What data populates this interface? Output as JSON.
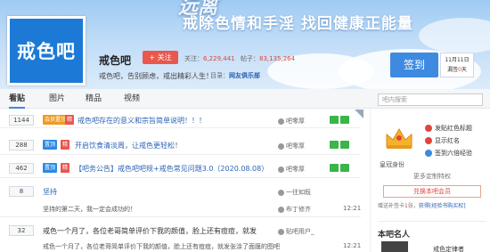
{
  "banner": {
    "slogan": "戒除色情和手淫 找回健康正能量",
    "top_text": "远离"
  },
  "logo": {
    "text": "戒色吧"
  },
  "forum": {
    "name": "戒色吧",
    "follow_label": "+ 关注",
    "members_label": "关注：",
    "members": "6,229,441",
    "posts_label": "帖子：",
    "posts": "83,135,264",
    "description": "戒色吧，告别顾虑，戒出精彩人生！",
    "directory_label": "目录：",
    "directory_link": "网友俱乐部"
  },
  "signin": {
    "label": "签到",
    "date": "11月11日",
    "streak_label": "漏签",
    "streak_num": "0",
    "streak_unit": "天"
  },
  "tabs": [
    {
      "label": "看贴"
    },
    {
      "label": "图片"
    },
    {
      "label": "精品"
    },
    {
      "label": "视频"
    }
  ],
  "search": {
    "placeholder": "吧内搜索"
  },
  "threads": [
    {
      "replies": "1144",
      "tags": [
        "会员置顶",
        "精"
      ],
      "title": "戒色吧存在的意义和宗旨简单说明！！！",
      "author": "吧零厚",
      "time": ""
    },
    {
      "replies": "288",
      "tags": [
        "置顶",
        "精"
      ],
      "title": "开启饮食清淡周，让戒色更轻松！",
      "author": "吧零厚",
      "time": ""
    },
    {
      "replies": "462",
      "tags": [
        "置顶",
        "精"
      ],
      "title": "【吧务公告】戒色吧吧规+戒色常见问题3.0（2020.08.08）",
      "author": "吧零厚",
      "time": ""
    },
    {
      "replies": "8",
      "tags": [],
      "title": "坚持",
      "preview": "坚持的第二天，我一定会成功的！",
      "author": "一往如既",
      "author2": "布丁修齐",
      "time": "12:21"
    },
    {
      "replies": "32",
      "tags": [],
      "title": "戒色一个月了，各位老哥简单评价下我的颜值，脸上还有痘痘，就发",
      "preview": "戒色一个月了，各位老哥简单评价下我的颜值，脸上还有痘痘，就发张涂了面膜的图吧",
      "author": "贴吧用户_",
      "time": "12:21"
    }
  ],
  "sidebar": {
    "links": [
      "发贴红色标题",
      "显示红名",
      "签到六倍经验",
      "更多定制特权"
    ],
    "crown_label": "皇冠身份",
    "more_perm": "更多定制特权",
    "vip_button": "兑换本吧会员",
    "gift_text_1": "赠送补签卡",
    "gift_num": "1",
    "gift_text_2": "张，",
    "gift_link": "获得[经验书购买权]",
    "famous_title": "本吧名人",
    "famous_name": "戒色定律者"
  },
  "colors": {
    "accent": "#3d8ae0",
    "red": "#e0453d",
    "link": "#2d64b3",
    "logo_bg": "#1c7ad6"
  }
}
